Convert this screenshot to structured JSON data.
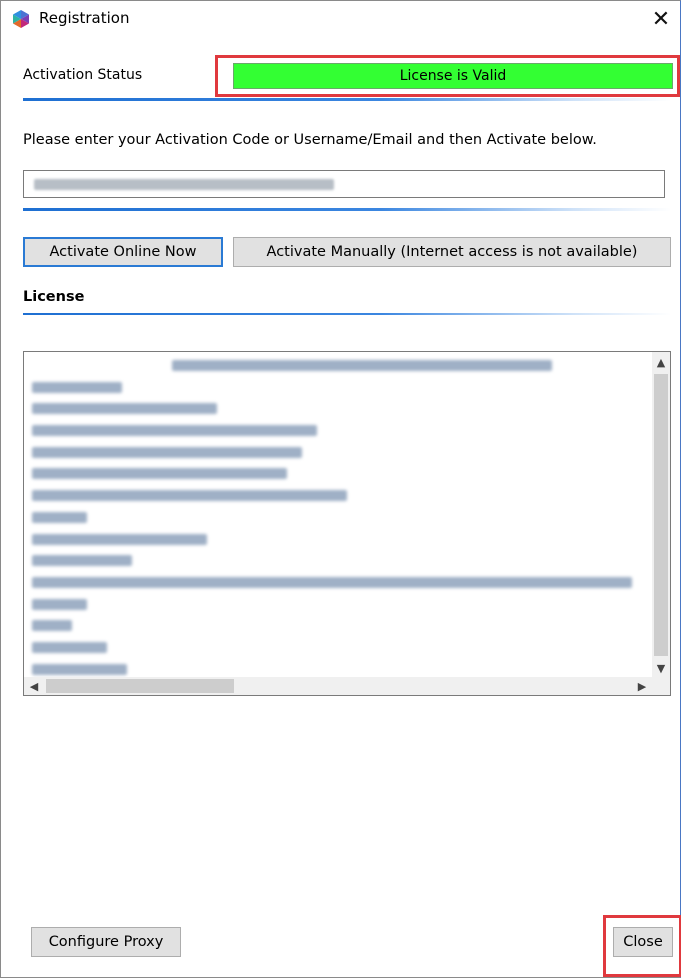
{
  "window": {
    "title": "Registration",
    "close_glyph": "✕"
  },
  "activation": {
    "status_label": "Activation Status",
    "status_text": "License is Valid",
    "status_color": "#33ff33",
    "instruction": "Please enter your Activation Code or Username/Email and then Activate below.",
    "code_value": ""
  },
  "buttons": {
    "activate_online": "Activate Online Now",
    "activate_manually": "Activate Manually (Internet access is not available)",
    "configure_proxy": "Configure Proxy",
    "close": "Close"
  },
  "license": {
    "section_label": "License",
    "content_obscured": true
  },
  "icons": {
    "app": "registration-app-icon",
    "scroll_up": "▲",
    "scroll_down": "▼",
    "scroll_left": "◀",
    "scroll_right": "▶"
  },
  "colors": {
    "accent": "#1e6fd2",
    "highlight": "#e0393e"
  }
}
